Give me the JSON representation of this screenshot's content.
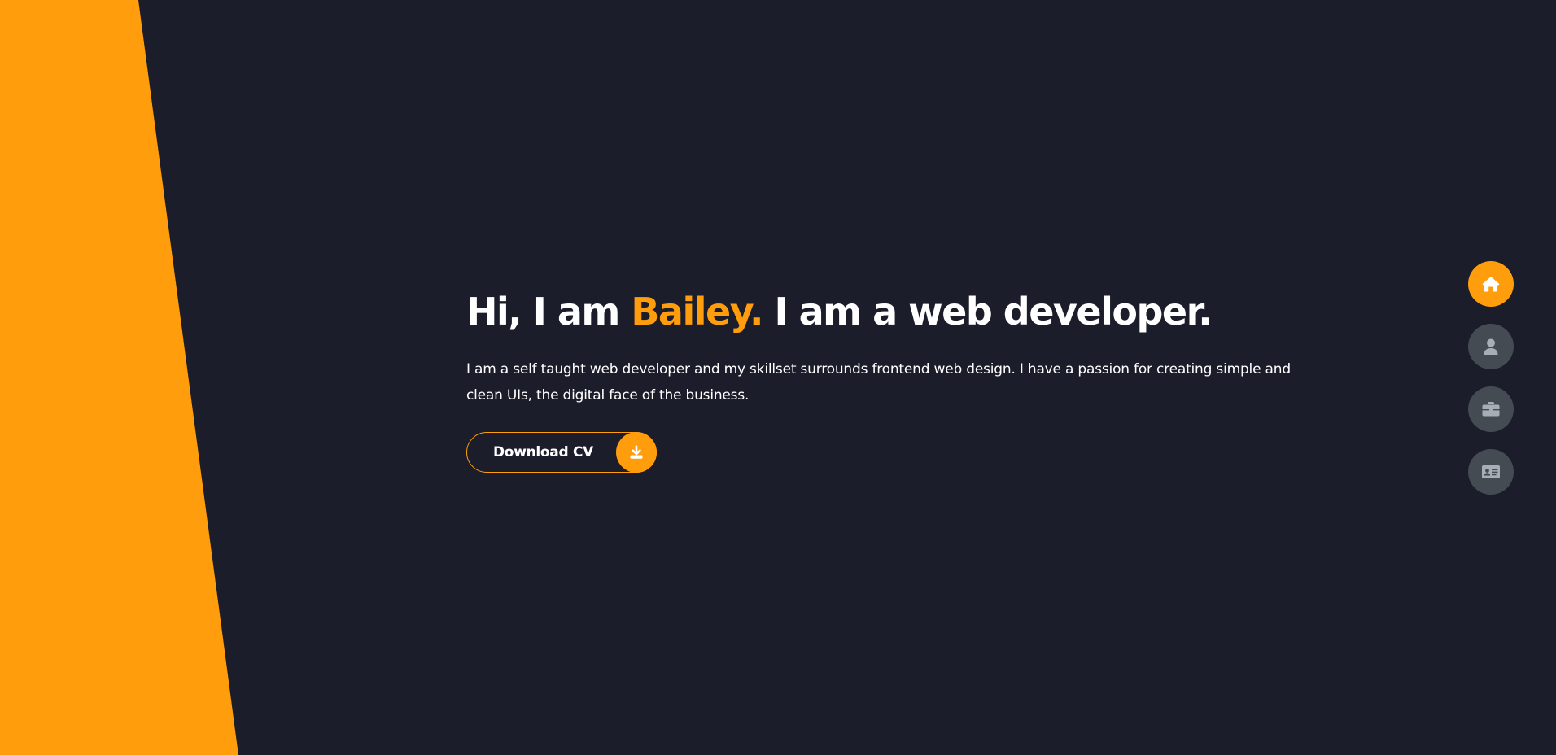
{
  "colors": {
    "background": "#1b1d2a",
    "accent": "#ff9d0c",
    "nav_inactive": "#454b52",
    "text": "#ffffff"
  },
  "hero": {
    "title_prefix": "Hi, I am ",
    "title_name": "Bailey.",
    "title_suffix": " I am a web developer.",
    "description": "I am a self taught web developer and my skillset surrounds frontend web design. I have a passion for creating simple and clean UIs, the digital face of the business."
  },
  "cv_button": {
    "label": "Download CV",
    "icon": "download-icon"
  },
  "nav": {
    "items": [
      {
        "icon": "home-icon",
        "active": true
      },
      {
        "icon": "user-icon",
        "active": false
      },
      {
        "icon": "briefcase-icon",
        "active": false
      },
      {
        "icon": "contact-card-icon",
        "active": false
      }
    ]
  }
}
